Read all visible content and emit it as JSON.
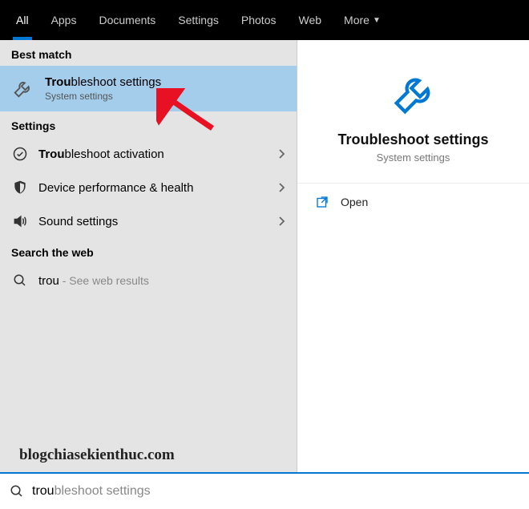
{
  "nav": {
    "items": [
      {
        "label": "All",
        "active": true
      },
      {
        "label": "Apps",
        "active": false
      },
      {
        "label": "Documents",
        "active": false
      },
      {
        "label": "Settings",
        "active": false
      },
      {
        "label": "Photos",
        "active": false
      },
      {
        "label": "Web",
        "active": false
      },
      {
        "label": "More",
        "active": false,
        "dropdown": true
      }
    ]
  },
  "sections": {
    "best_match_label": "Best match",
    "settings_label": "Settings",
    "web_label": "Search the web"
  },
  "best_match": {
    "title_bold": "Trou",
    "title_rest": "bleshoot settings",
    "subtitle": "System settings"
  },
  "settings_items": [
    {
      "icon": "tick-circle",
      "bold": "Trou",
      "rest": "bleshoot activation"
    },
    {
      "icon": "shield",
      "bold": "",
      "rest": "Device performance & health"
    },
    {
      "icon": "sound",
      "bold": "",
      "rest": "Sound settings"
    }
  ],
  "web_item": {
    "query": "trou",
    "hint": " - See web results"
  },
  "detail": {
    "title": "Troubleshoot settings",
    "subtitle": "System settings",
    "actions": [
      {
        "icon": "open",
        "label": "Open"
      }
    ]
  },
  "search": {
    "typed": "trou",
    "suggest": "bleshoot settings"
  },
  "watermark": "blogchiasekienthuc.com"
}
